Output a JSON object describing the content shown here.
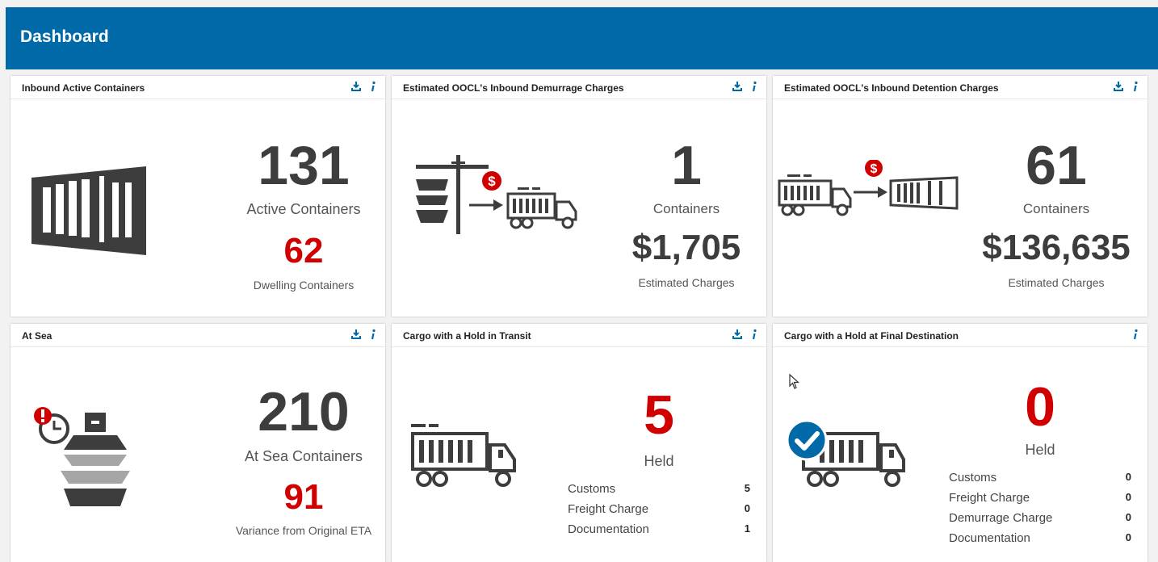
{
  "header": {
    "title": "Dashboard"
  },
  "cards": [
    {
      "title": "Inbound Active Containers",
      "primary_value": "131",
      "primary_label": "Active Containers",
      "secondary_value": "62",
      "secondary_label": "Dwelling Containers",
      "tools": [
        "download-icon",
        "info-icon"
      ]
    },
    {
      "title": "Estimated OOCL's Inbound Demurrage Charges",
      "primary_value": "1",
      "primary_label": "Containers",
      "secondary_value": "$1,705",
      "secondary_label": "Estimated Charges",
      "tools": [
        "download-icon",
        "info-icon"
      ]
    },
    {
      "title": "Estimated OOCL's Inbound Detention Charges",
      "primary_value": "61",
      "primary_label": "Containers",
      "secondary_value": "$136,635",
      "secondary_label": "Estimated Charges",
      "tools": [
        "download-icon",
        "info-icon"
      ]
    },
    {
      "title": "At Sea",
      "primary_value": "210",
      "primary_label": "At Sea Containers",
      "secondary_value": "91",
      "secondary_label": "Variance from Original ETA",
      "tools": [
        "download-icon",
        "info-icon"
      ]
    },
    {
      "title": "Cargo with a Hold in Transit",
      "primary_value": "5",
      "primary_label": "Held",
      "holds": [
        {
          "label": "Customs",
          "value": "5"
        },
        {
          "label": "Freight Charge",
          "value": "0"
        },
        {
          "label": "Documentation",
          "value": "1"
        }
      ],
      "tools": [
        "download-icon",
        "info-icon"
      ]
    },
    {
      "title": "Cargo with a Hold at Final Destination",
      "primary_value": "0",
      "primary_label": "Held",
      "holds": [
        {
          "label": "Customs",
          "value": "0"
        },
        {
          "label": "Freight Charge",
          "value": "0"
        },
        {
          "label": "Demurrage Charge",
          "value": "0"
        },
        {
          "label": "Documentation",
          "value": "0"
        }
      ],
      "tools": [
        "info-icon"
      ]
    }
  ],
  "colors": {
    "brand": "#0069a7",
    "alert": "#d00000",
    "icon": "#3d3d3d"
  }
}
